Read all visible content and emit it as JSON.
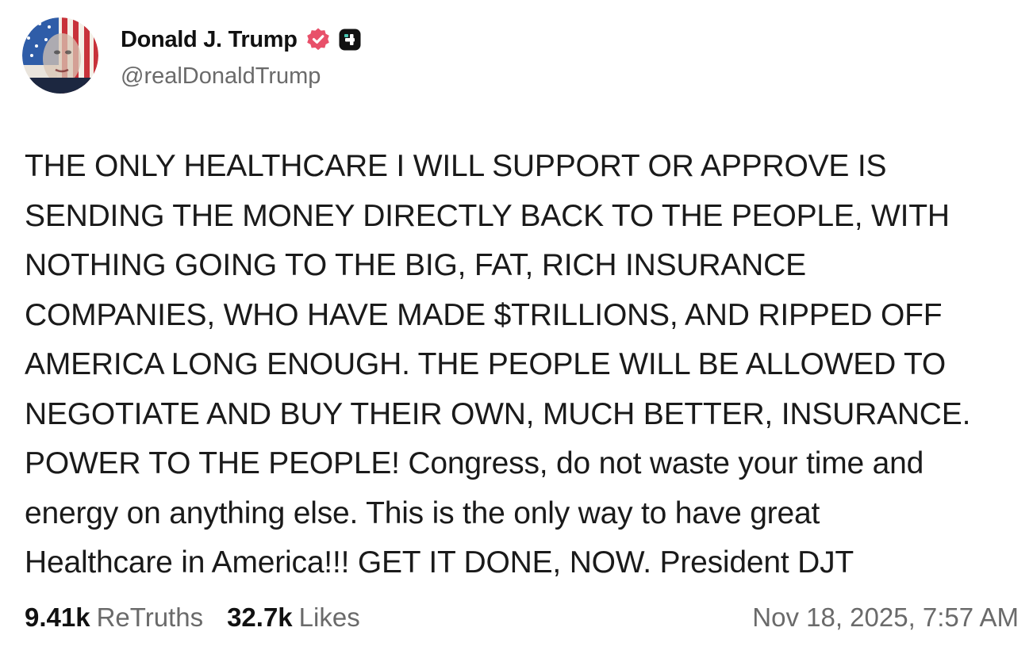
{
  "author": {
    "display_name": "Donald J. Trump",
    "handle": "@realDonaldTrump",
    "verified_icon": "verified-badge-icon",
    "subscriber_icon": "truth-plus-icon"
  },
  "post": {
    "text": "THE ONLY HEALTHCARE I WILL SUPPORT OR APPROVE IS\nSENDING THE MONEY DIRECTLY BACK TO THE PEOPLE, WITH\nNOTHING GOING TO THE BIG, FAT, RICH INSURANCE\nCOMPANIES, WHO HAVE MADE $TRILLIONS, AND RIPPED OFF\nAMERICA LONG ENOUGH. THE PEOPLE WILL BE ALLOWED TO\nNEGOTIATE AND BUY THEIR OWN, MUCH BETTER, INSURANCE.\nPOWER TO THE PEOPLE! Congress, do not waste your time and\nenergy on anything else. This is the only way to have great\nHealthcare in America!!! GET IT DONE, NOW. President DJT"
  },
  "stats": {
    "retruths_count": "9.41k",
    "retruths_label": "ReTruths",
    "likes_count": "32.7k",
    "likes_label": "Likes"
  },
  "timestamp": "Nov 18, 2025, 7:57 AM",
  "colors": {
    "text": "#111111",
    "muted": "#6a6a6a",
    "verified_badge": "#e8506a",
    "background": "#ffffff"
  }
}
